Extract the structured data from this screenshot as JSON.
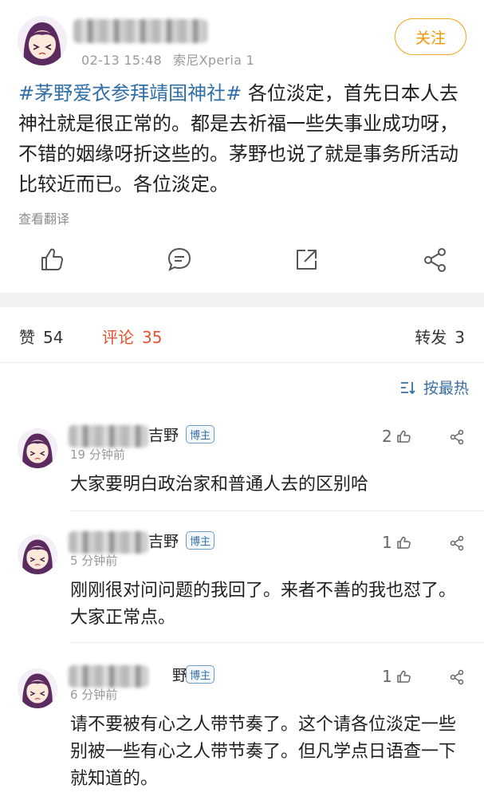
{
  "post": {
    "author_name_obscured": "",
    "time": "02-13 15:48",
    "device": "索尼Xperia 1",
    "follow_label": "关注",
    "hashtag": "#茅野爱衣参拜靖国神社#",
    "body": " 各位淡定，首先日本人去神社就是很正常的。都是去祈福一些失事业成功呀，不错的姻缘呀折这些的。茅野也说了就是事务所活动比较近而已。各位淡定。",
    "translate_label": "查看翻译"
  },
  "stats": {
    "like_label": "赞",
    "like_count": "54",
    "comment_label": "评论",
    "comment_count": "35",
    "repost_label": "转发",
    "repost_count": "3"
  },
  "sort": {
    "label": "按最热"
  },
  "comments": [
    {
      "name_tail": "吉野",
      "badge": "博主",
      "time": "19 分钟前",
      "likes": "2",
      "text": "大家要明白政治家和普通人去的区别哈"
    },
    {
      "name_tail": "吉野",
      "badge": "博主",
      "time": "5 分钟前",
      "likes": "1",
      "text": "刚刚很对问问题的我回了。来者不善的我也怼了。大家正常点。"
    },
    {
      "name_tail": "野",
      "badge": "博主",
      "time": "6 分钟前",
      "likes": "1",
      "text": "请不要被有心之人带节奏了。这个请各位淡定一些别被一些有心之人带节奏了。但凡学点日语查一下就知道的。"
    }
  ],
  "colors": {
    "accent_orange": "#f09400",
    "link_blue": "#2f6ea6",
    "comment_red": "#e2532d"
  },
  "icons": [
    "like-icon",
    "comment-icon",
    "repost-icon",
    "share-icon",
    "sort-icon"
  ]
}
